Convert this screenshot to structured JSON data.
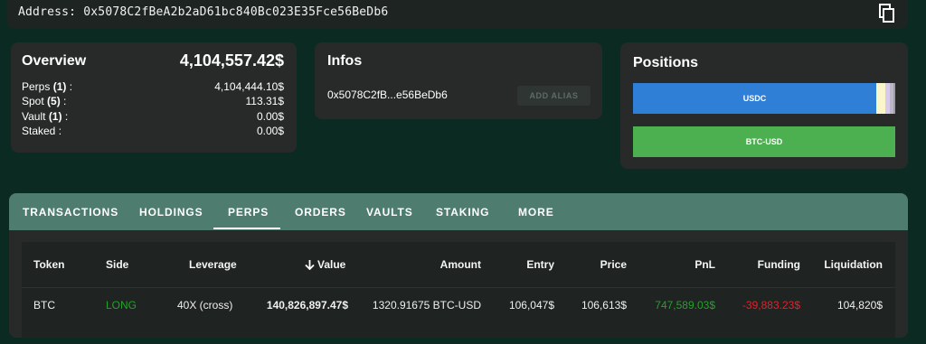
{
  "address": {
    "label": "Address:",
    "value": "0x5078C2fBeA2b2aD61bc840Bc023E35Fce56BeDb6",
    "copy_icon": "copy-icon"
  },
  "overview": {
    "title": "Overview",
    "total": "4,104,557.42$",
    "rows": [
      {
        "label": "Perps",
        "count": "(1)",
        "value": "4,104,444.10$"
      },
      {
        "label": "Spot",
        "count": "(5)",
        "value": "113.31$"
      },
      {
        "label": "Vault",
        "count": "(1)",
        "value": "0.00$"
      },
      {
        "label": "Staked",
        "count": "",
        "value": "0.00$"
      }
    ]
  },
  "infos": {
    "title": "Infos",
    "short_address": "0x5078C2fB...e56BeDb6",
    "alias_button": "ADD ALIAS"
  },
  "positions": {
    "title": "Positions",
    "bars": [
      {
        "label": "USDC",
        "color": "#2f7fd7"
      },
      {
        "label": "BTC-USD",
        "color": "#4caf50"
      }
    ]
  },
  "tabs": [
    "TRANSACTIONS",
    "HOLDINGS",
    "PERPS",
    "ORDERS",
    "VAULTS",
    "STAKING",
    "MORE"
  ],
  "active_tab": "PERPS",
  "table": {
    "headers": [
      "Token",
      "Side",
      "Leverage",
      "Value",
      "Amount",
      "Entry",
      "Price",
      "PnL",
      "Funding",
      "Liquidation"
    ],
    "sort_icon": "arrow-down-icon",
    "rows": [
      {
        "token": "BTC",
        "side": "LONG",
        "leverage": "40X (cross)",
        "value": "140,826,897.47$",
        "amount": "1320.91675 BTC-USD",
        "entry": "106,047$",
        "price": "106,613$",
        "pnl": "747,589.03$",
        "funding": "-39,883.23$",
        "liquidation": "104,820$"
      }
    ]
  },
  "colors": {
    "background": "#0b2a22",
    "tab_bar": "#4e7c6e",
    "positive": "#27a02b",
    "negative": "#e2232a"
  }
}
